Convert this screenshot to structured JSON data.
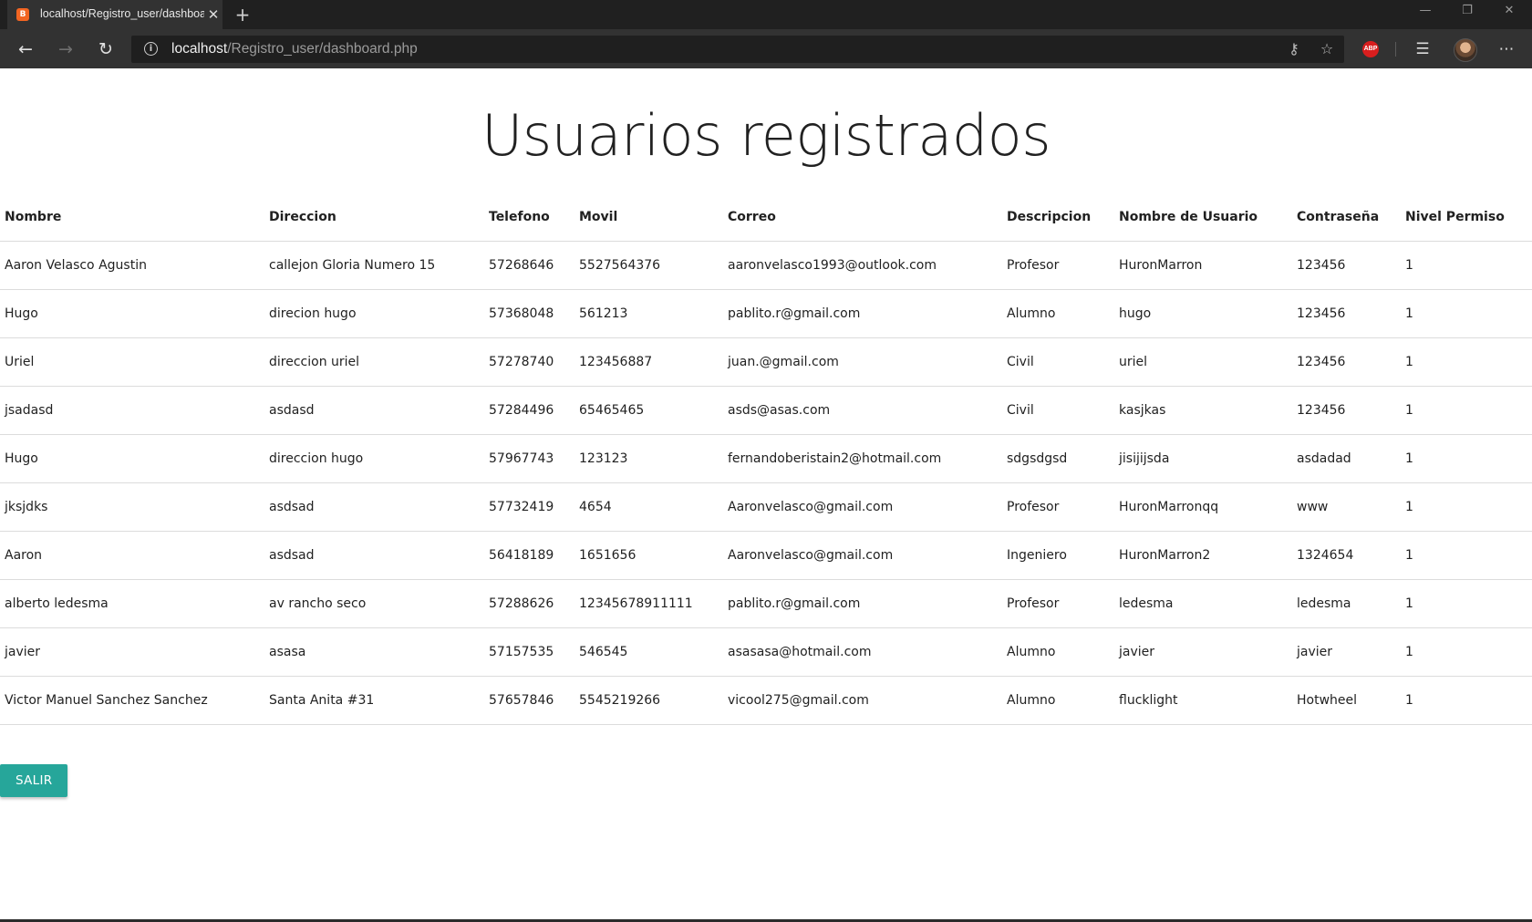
{
  "browser": {
    "tab_title": "localhost/Registro_user/dashboard.php",
    "new_tab_symbol": "+",
    "url_host": "localhost",
    "url_path": "/Registro_user/dashboard.php",
    "favicon_text": "B",
    "abp_label": "ABP"
  },
  "page": {
    "title": "Usuarios registrados"
  },
  "table": {
    "headers": [
      "Nombre",
      "Direccion",
      "Telefono",
      "Movil",
      "Correo",
      "Descripcion",
      "Nombre de Usuario",
      "Contraseña",
      "Nivel Permiso"
    ],
    "rows": [
      [
        "Aaron Velasco Agustin",
        "callejon Gloria Numero 15",
        "57268646",
        "5527564376",
        "aaronvelasco1993@outlook.com",
        "Profesor",
        "HuronMarron",
        "123456",
        "1"
      ],
      [
        "Hugo",
        "direcion hugo",
        "57368048",
        "561213",
        "pablito.r@gmail.com",
        "Alumno",
        "hugo",
        "123456",
        "1"
      ],
      [
        "Uriel",
        "direccion uriel",
        "57278740",
        "123456887",
        "juan.@gmail.com",
        "Civil",
        "uriel",
        "123456",
        "1"
      ],
      [
        "jsadasd",
        "asdasd",
        "57284496",
        "65465465",
        "asds@asas.com",
        "Civil",
        "kasjkas",
        "123456",
        "1"
      ],
      [
        "Hugo",
        "direccion hugo",
        "57967743",
        "123123",
        "fernandoberistain2@hotmail.com",
        "sdgsdgsd",
        "jisijijsda",
        "asdadad",
        "1"
      ],
      [
        "jksjdks",
        "asdsad",
        "57732419",
        "4654",
        "Aaronvelasco@gmail.com",
        "Profesor",
        "HuronMarronqq",
        "www",
        "1"
      ],
      [
        "Aaron",
        "asdsad",
        "56418189",
        "1651656",
        "Aaronvelasco@gmail.com",
        "Ingeniero",
        "HuronMarron2",
        "1324654",
        "1"
      ],
      [
        "alberto ledesma",
        "av rancho seco",
        "57288626",
        "12345678911111",
        "pablito.r@gmail.com",
        "Profesor",
        "ledesma",
        "ledesma",
        "1"
      ],
      [
        "javier",
        "asasa",
        "57157535",
        "546545",
        "asasasa@hotmail.com",
        "Alumno",
        "javier",
        "javier",
        "1"
      ],
      [
        "Victor Manuel Sanchez Sanchez",
        "Santa Anita #31",
        "57657846",
        "5545219266",
        "vicool275@gmail.com",
        "Alumno",
        "flucklight",
        "Hotwheel",
        "1"
      ]
    ]
  },
  "actions": {
    "salir_label": "SALIR"
  },
  "colors": {
    "button": "#26a69a",
    "chrome": "#323232"
  }
}
